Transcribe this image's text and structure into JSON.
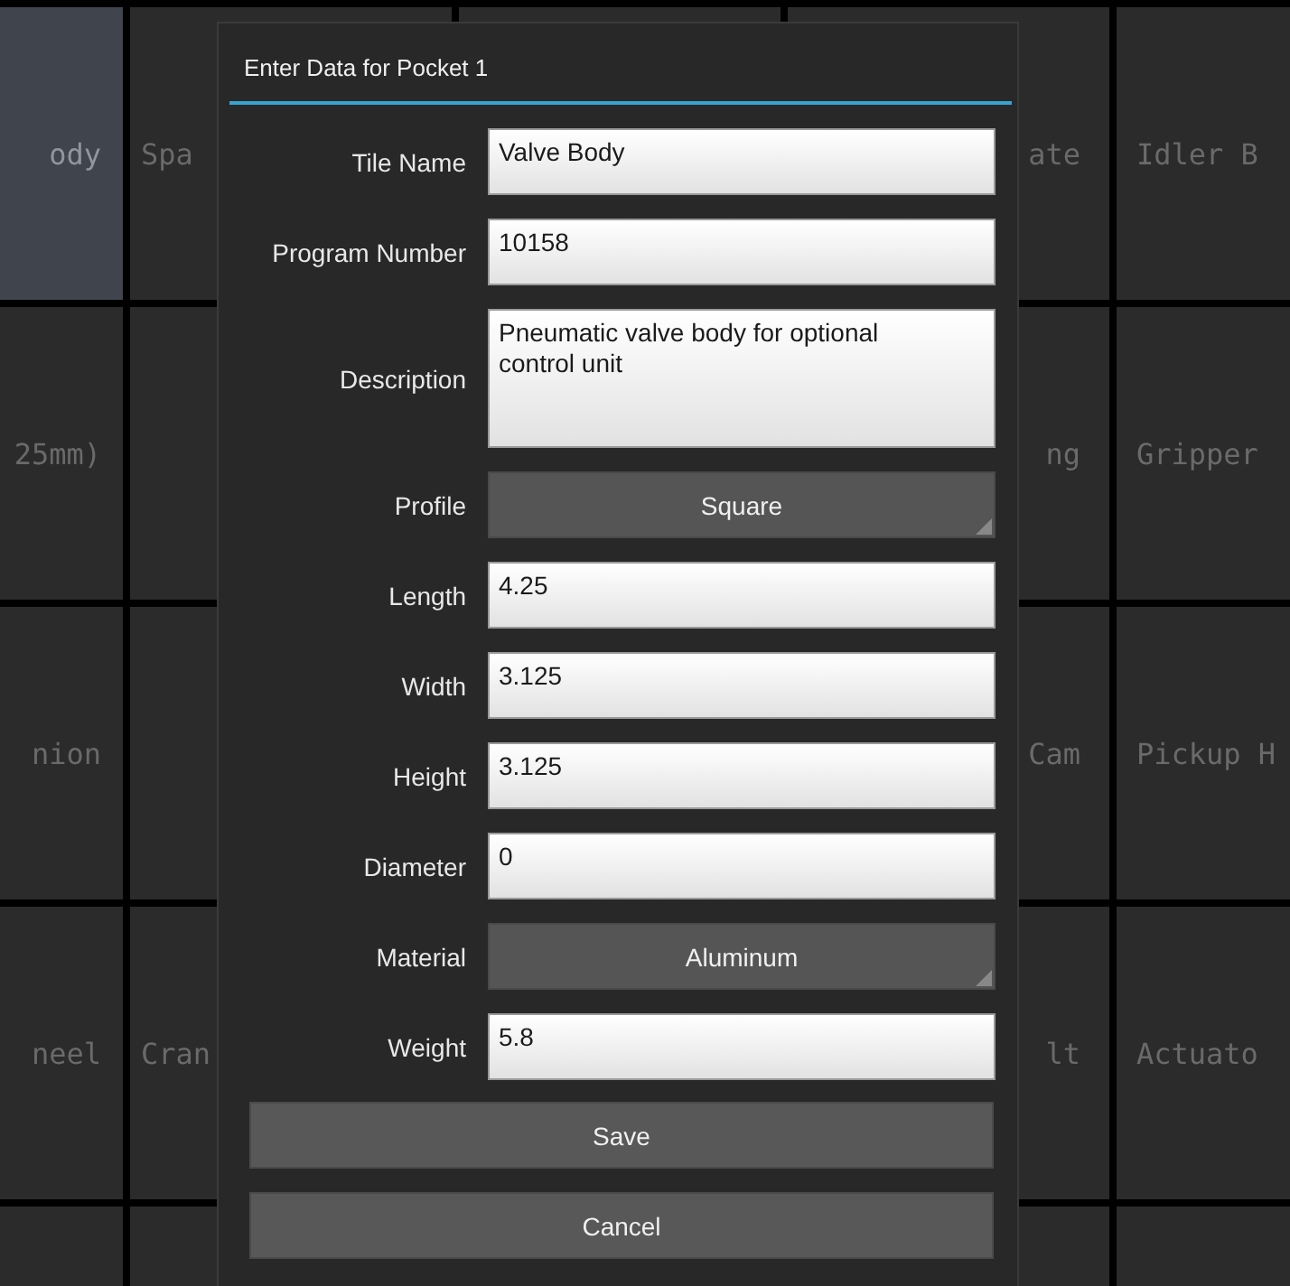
{
  "tile_rows": [
    {
      "left": [
        {
          "label": "ody",
          "selected": true
        },
        {
          "label": "Spa",
          "selected": false
        }
      ],
      "right": [
        {
          "label": "ate",
          "selected": false
        },
        {
          "label": "Idler B",
          "selected": false
        }
      ]
    },
    {
      "left": [
        {
          "label": "25mm)",
          "selected": false
        },
        {
          "selected": false
        }
      ],
      "right": [
        {
          "label": "ng",
          "selected": false
        },
        {
          "label": "Gripper",
          "selected": false
        }
      ]
    },
    {
      "left": [
        {
          "label": "nion",
          "selected": false
        },
        {
          "selected": false
        }
      ],
      "right": [
        {
          "label": "Cam",
          "selected": false
        },
        {
          "label": "Pickup H",
          "selected": false
        }
      ]
    },
    {
      "left": [
        {
          "label": "neel",
          "selected": false
        },
        {
          "label": "Cran",
          "selected": false
        }
      ],
      "right": [
        {
          "label": "lt",
          "selected": false
        },
        {
          "label": "Actuato",
          "selected": false
        }
      ]
    },
    {
      "left": [
        {
          "selected": false
        },
        {
          "selected": false
        }
      ],
      "right": [
        {
          "selected": false
        },
        {
          "selected": false
        }
      ]
    }
  ],
  "dialog": {
    "title": "Enter Data for Pocket 1",
    "fields": [
      {
        "label": "Tile Name",
        "kind": "text",
        "value": "Valve Body"
      },
      {
        "label": "Program Number",
        "kind": "text",
        "value": "10158"
      },
      {
        "label": "Description",
        "kind": "textarea",
        "value": "Pneumatic valve body for optional control unit"
      },
      {
        "label": "Profile",
        "kind": "select",
        "value": "Square"
      },
      {
        "label": "Length",
        "kind": "text",
        "value": "4.25"
      },
      {
        "label": "Width",
        "kind": "text",
        "value": "3.125"
      },
      {
        "label": "Height",
        "kind": "text",
        "value": "3.125"
      },
      {
        "label": "Diameter",
        "kind": "text",
        "value": "0"
      },
      {
        "label": "Material",
        "kind": "select",
        "value": "Aluminum"
      },
      {
        "label": "Weight",
        "kind": "text",
        "value": "5.8"
      }
    ],
    "buttons": [
      "Save",
      "Cancel"
    ]
  }
}
